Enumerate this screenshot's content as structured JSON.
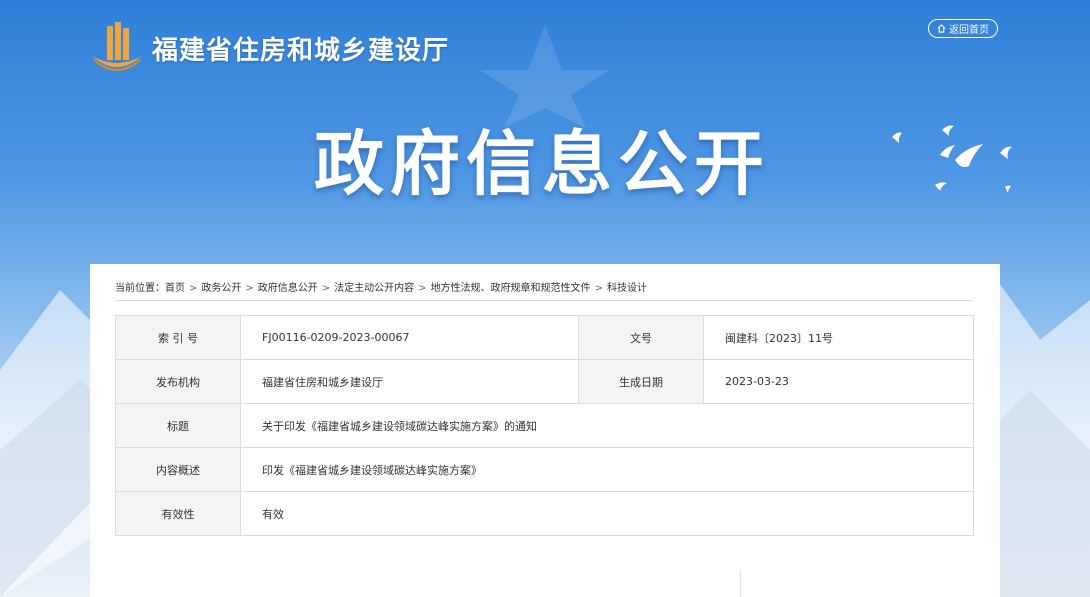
{
  "header": {
    "site_title": "福建省住房和城乡建设厅",
    "home_button_label": "返回首页",
    "hero_title": "政府信息公开"
  },
  "breadcrumb": {
    "prefix": "当前位置：",
    "items": [
      "首页",
      "政务公开",
      "政府信息公开",
      "法定主动公开内容",
      "地方性法规、政府规章和规范性文件",
      "科技设计"
    ]
  },
  "meta": {
    "index_label": "索 引 号",
    "index_value": "FJ00116-0209-2023-00067",
    "doc_no_label": "文号",
    "doc_no_value": "闽建科〔2023〕11号",
    "publisher_label": "发布机构",
    "publisher_value": "福建省住房和城乡建设厅",
    "date_label": "生成日期",
    "date_value": "2023-03-23",
    "title_label": "标题",
    "title_value": "关于印发《福建省城乡建设领域碳达峰实施方案》的通知",
    "summary_label": "内容概述",
    "summary_value": "印发《福建省城乡建设领域碳达峰实施方案》",
    "validity_label": "有效性",
    "validity_value": "有效"
  },
  "colors": {
    "banner_blue": "#2f7fd9",
    "logo_gold": "#e8a23a",
    "table_key_bg": "#f4f4f4"
  }
}
